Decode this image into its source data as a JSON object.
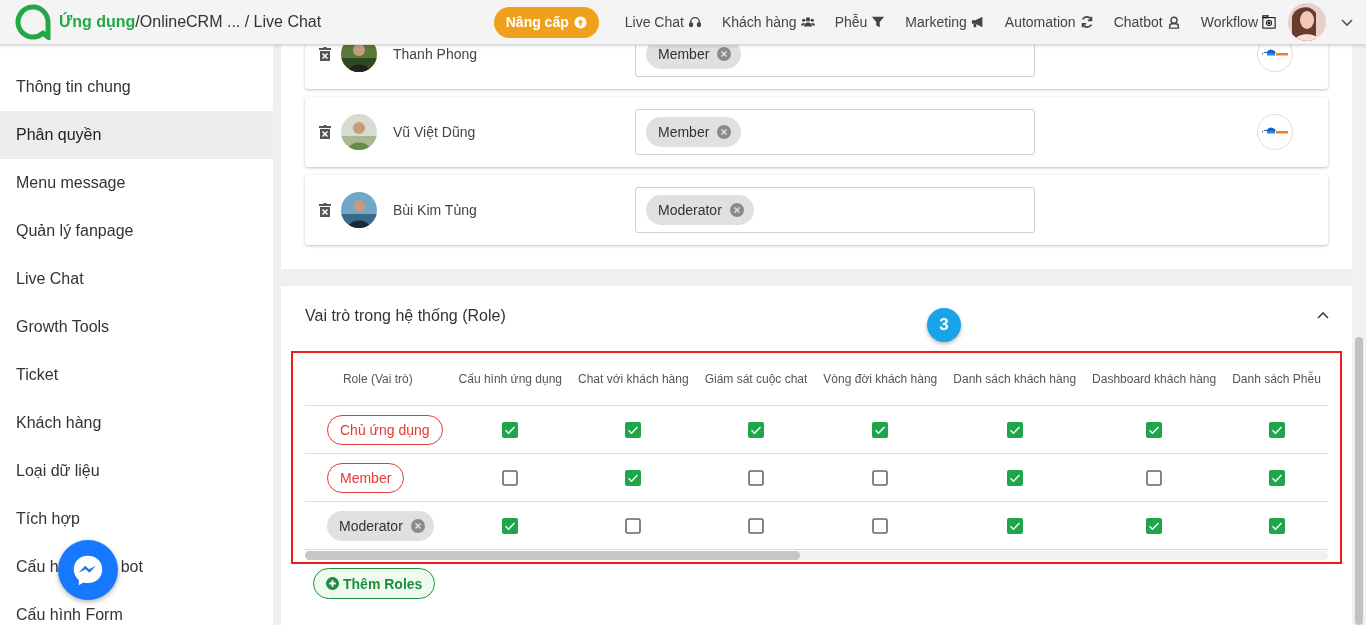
{
  "header": {
    "app_link": "Ứng dụng",
    "path": "/OnlineCRM ... / Live Chat",
    "upgrade_button": "Nâng cấp",
    "nav": [
      {
        "label": "Live Chat"
      },
      {
        "label": "Khách hàng"
      },
      {
        "label": "Phễu"
      },
      {
        "label": "Marketing"
      },
      {
        "label": "Automation"
      },
      {
        "label": "Chatbot"
      },
      {
        "label": "Workflow"
      }
    ]
  },
  "sidebar": {
    "items": [
      {
        "label": "Thông tin chung",
        "selected": false
      },
      {
        "label": "Phân quyền",
        "selected": true
      },
      {
        "label": "Menu message",
        "selected": false
      },
      {
        "label": "Quản lý fanpage",
        "selected": false
      },
      {
        "label": "Live Chat",
        "selected": false
      },
      {
        "label": "Growth Tools",
        "selected": false
      },
      {
        "label": "Ticket",
        "selected": false
      },
      {
        "label": "Khách hàng",
        "selected": false
      },
      {
        "label": "Loại dữ liệu",
        "selected": false
      },
      {
        "label": "Tích hợp",
        "selected": false
      },
      {
        "parts": [
          "Cấu h",
          "bot"
        ],
        "selected": false
      },
      {
        "label": "Cấu hình Form",
        "selected": false
      }
    ]
  },
  "members": [
    {
      "name": "Thanh Phong",
      "role": "Member",
      "has_logo": true
    },
    {
      "name": "Vũ Việt Dũng",
      "role": "Member",
      "has_logo": true
    },
    {
      "name": "Bùi Kim Tùng",
      "role": "Moderator",
      "has_logo": false
    }
  ],
  "roles_panel": {
    "title": "Vai trò trong hệ thống (Role)",
    "expanded": true,
    "step": "3",
    "table": {
      "columns": [
        "Role (Vai trò)",
        "Cấu hình ứng dụng",
        "Chat với khách hàng",
        "Giám sát cuộc chat",
        "Vòng đời khách hàng",
        "Danh sách khách hàng",
        "Dashboard khách hàng",
        "Danh sách Phễu"
      ],
      "rows": [
        {
          "role": "Chủ ứng dụng",
          "kind": "outlined",
          "permissions": [
            true,
            true,
            true,
            true,
            true,
            true,
            true
          ]
        },
        {
          "role": "Member",
          "kind": "outlined",
          "permissions": [
            false,
            true,
            false,
            false,
            true,
            false,
            true
          ]
        },
        {
          "role": "Moderator",
          "kind": "chip",
          "permissions": [
            true,
            false,
            false,
            false,
            true,
            true,
            true
          ]
        }
      ]
    },
    "add_button": "Thêm Roles"
  }
}
